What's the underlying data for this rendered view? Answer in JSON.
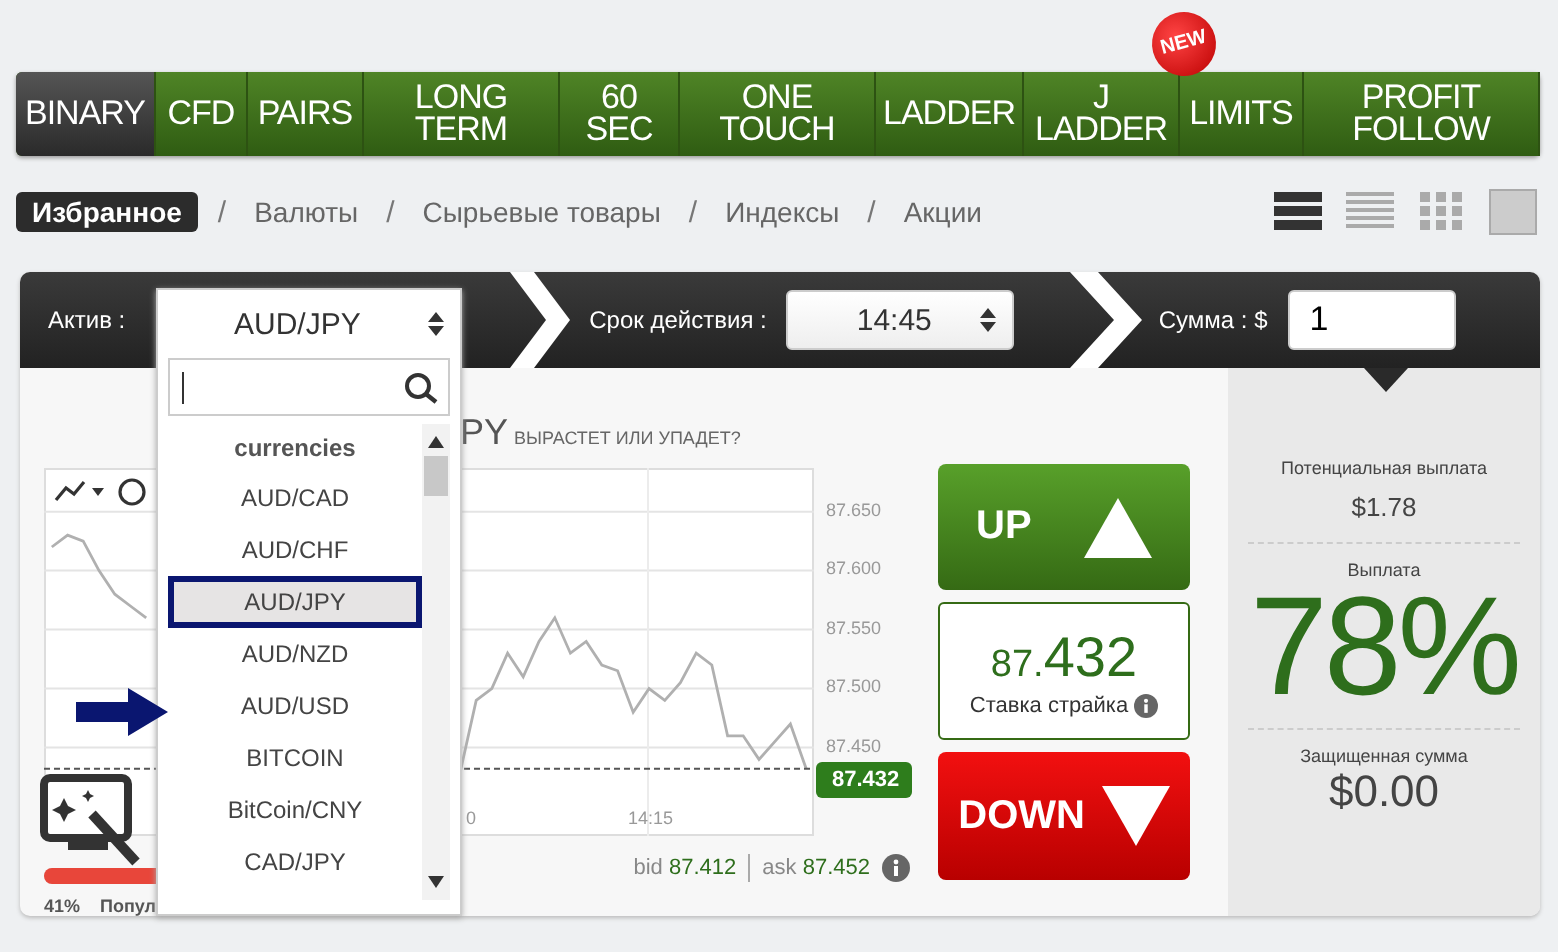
{
  "nav_tabs": [
    {
      "label": "BINARY",
      "selected": true
    },
    {
      "label": "CFD",
      "selected": false
    },
    {
      "label": "PAIRS",
      "selected": false
    },
    {
      "label": "LONG TERM",
      "selected": false
    },
    {
      "label": "60 SEC",
      "selected": false
    },
    {
      "label": "ONE TOUCH",
      "selected": false
    },
    {
      "label": "LADDER",
      "selected": false
    },
    {
      "label": "J LADDER",
      "selected": false
    },
    {
      "label": "LIMITS",
      "selected": false,
      "badge": "NEW"
    },
    {
      "label": "PROFIT FOLLOW",
      "selected": false
    }
  ],
  "category_separator": "/",
  "categories": [
    {
      "label": "Избранное",
      "selected": true
    },
    {
      "label": "Валюты",
      "selected": false
    },
    {
      "label": "Сырьевые товары",
      "selected": false
    },
    {
      "label": "Индексы",
      "selected": false
    },
    {
      "label": "Акции",
      "selected": false
    }
  ],
  "view_options": [
    {
      "kind": "thick-list",
      "selected": true
    },
    {
      "kind": "thin-list",
      "selected": false
    },
    {
      "kind": "grid",
      "selected": false
    },
    {
      "kind": "tile",
      "selected": false
    }
  ],
  "trade_bar": {
    "asset_label": "Актив :",
    "expiry_label": "Срок действия :",
    "expiry_value": "14:45",
    "amount_label": "Сумма : $",
    "amount_value": "1"
  },
  "chart": {
    "title": "PY",
    "subtitle": "ВЫРАСТЕТ ИЛИ УПАДЕТ?",
    "x_labels": [
      "0",
      "14:15"
    ],
    "chart_data": {
      "type": "line",
      "grid": true,
      "ylim": [
        87.375,
        87.687
      ],
      "yticks": [
        {
          "value": 87.65,
          "label": "87.650"
        },
        {
          "value": 87.6,
          "label": "87.600"
        },
        {
          "value": 87.55,
          "label": "87.550"
        },
        {
          "value": 87.5,
          "label": "87.500"
        },
        {
          "value": 87.45,
          "label": "87.450"
        }
      ],
      "ref_lines": [
        {
          "axis": "y",
          "value": 87.432,
          "label": "87.432"
        }
      ],
      "series": [
        {
          "color": "#b0b0b0",
          "values": [
            87.62,
            87.63,
            87.625,
            87.6,
            87.58,
            87.57,
            87.56,
            null,
            null,
            null,
            null,
            null,
            null,
            null,
            null,
            null,
            null,
            null,
            null,
            null,
            null,
            null,
            null,
            null,
            null,
            null,
            87.43,
            87.49,
            87.5,
            87.53,
            87.51,
            87.54,
            87.56,
            87.53,
            87.54,
            87.52,
            87.515,
            87.48,
            87.5,
            87.49,
            87.505,
            87.53,
            87.52,
            87.46,
            87.46,
            87.44,
            87.455,
            87.47,
            87.432
          ]
        }
      ]
    },
    "bid_label": "bid",
    "bid": "87.412",
    "ask_label": "ask",
    "ask": "87.452"
  },
  "sentiment": {
    "percent": "41%",
    "label": "Попул",
    "level": 0.41
  },
  "up_button": "UP",
  "strike": {
    "prefix": "87.",
    "main": "432",
    "label": "Ставка страйка"
  },
  "down_button": "DOWN",
  "payout": {
    "potential_label": "Потенциальная выплата",
    "potential_value": "$1.78",
    "rate_label": "Выплата",
    "rate_value": "78%",
    "protected_label": "Защищенная сумма",
    "protected_value": "$0.00"
  },
  "asset_dropdown": {
    "value": "AUD/JPY",
    "group": "currencies",
    "items": [
      {
        "label": "AUD/CAD",
        "selected": false
      },
      {
        "label": "AUD/CHF",
        "selected": false
      },
      {
        "label": "AUD/JPY",
        "selected": true
      },
      {
        "label": "AUD/NZD",
        "selected": false
      },
      {
        "label": "AUD/USD",
        "selected": false
      },
      {
        "label": "BITCOIN",
        "selected": false
      },
      {
        "label": "BitCoin/CNY",
        "selected": false
      },
      {
        "label": "CAD/JPY",
        "selected": false
      }
    ]
  }
}
